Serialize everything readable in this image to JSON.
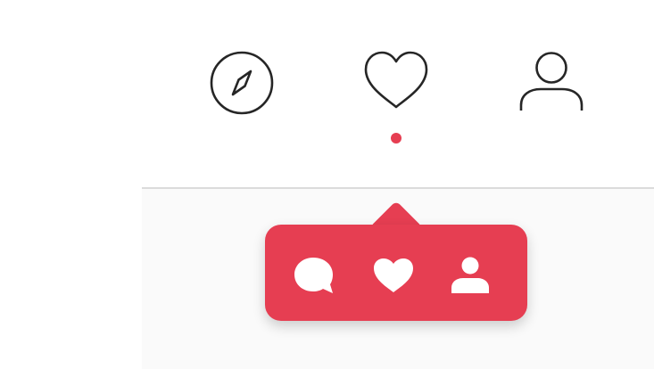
{
  "colors": {
    "accent": "#e63e52",
    "icon_stroke": "#262626",
    "divider": "#dbdbdb",
    "content_bg": "#fafafa",
    "popup_icon": "#ffffff"
  },
  "nav": {
    "items": [
      {
        "icon": "compass-icon"
      },
      {
        "icon": "heart-icon"
      },
      {
        "icon": "user-icon"
      }
    ]
  },
  "activity_popup": {
    "icons": [
      "comment-icon",
      "heart-icon",
      "user-icon"
    ]
  }
}
